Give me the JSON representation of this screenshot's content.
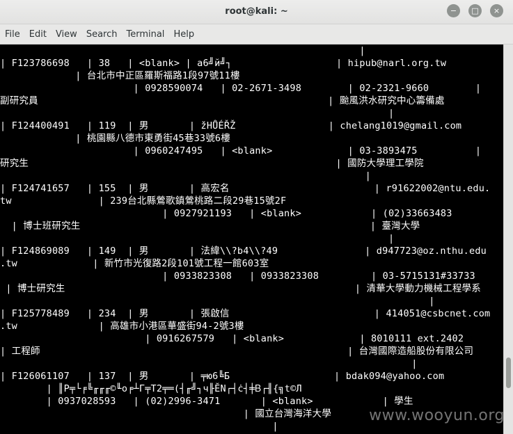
{
  "window": {
    "title": "root@kali: ~",
    "buttons": {
      "minimize": "−",
      "maximize": "□",
      "close": "×"
    }
  },
  "menu": [
    "File",
    "Edit",
    "View",
    "Search",
    "Terminal",
    "Help"
  ],
  "terminal_lines": [
    "                                                              |",
    "| F123786698   | 38   | <blank> | а6╝й╝┐                  | hipub@narl.org.tw",
    "             | 台北市中正區羅斯福路1段97號11樓",
    "                       | 0928590074   | 02-2671-3498        | 02-2321-9660        |",
    "副研究員                                                  | 颱風洪水研究中心籌備處",
    "                                                                   |",
    "| F124400491   | 119  | 男       | žHŮÉŘŽ                | chelang1019@gmail.com",
    "             | 桃園縣八德市東勇街45巷33號6樓",
    "                       | 0960247495   | <blank>             | 03-3893475          |",
    "研究生                                                     | 國防大學理工學院",
    "                                                               |",
    "| F124741657   | 155  | 男       | 高宏名                         | r91622002@ntu.edu.",
    "tw               | 239台北縣鶯歌鎮鶯桃路二段29巷15號2F",
    "                            | 0927921193   | <blank>            | (02)33663483",
    "  | 博士班研究生                                                  | 臺灣大學",
    "                                                                   |",
    "| F124869089   | 149  | 男       | 法緯\\\\?b4\\\\?49               | d947723@oz.nthu.edu",
    ".tw             | 新竹市光復路2段101號工程一館603室",
    "                            | 0933823308   | 0933823308         | 03-5715131#33733",
    " | 博士研究生                                                  | 清華大學動力機械工程學系",
    "                                                                          |",
    "| F125778489   | 234  | 男       | 張啟信                         | 414051@csbcnet.com",
    ".tw              | 高雄市小港區華盛街94-2號3樓",
    "                         | 0916267579   | <blank>             | 8010111 ext.2402",
    "| 工程師                                                     | 台灣國際造船股份有限公司",
    "                                                                       |",
    "| F126061107   | 137  | 男       | ╤ю6╚Б                  | bdak094@yahoo.com",
    "        | ║Р╤└╒╚╓╓╓©╙о╒┴Г╤T2╤═(┤╓╝┐ч╟ĔN┌┤ċ┤╪Ᏼ┌╢{╗t©Л",
    "        | 0937028593   | (02)2996-3471       | <blank>            | 學生",
    "                                          | 國立台灣海洋大學",
    "                                               |"
  ],
  "watermark": "www.wooyun.org"
}
